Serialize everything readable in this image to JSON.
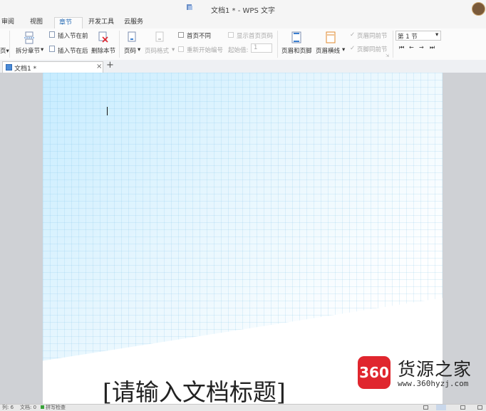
{
  "window": {
    "title": "文档1 * - WPS 文字"
  },
  "menu": {
    "tabs": [
      "审阅",
      "视图",
      "章节",
      "开发工具",
      "云服务"
    ],
    "active": "章节"
  },
  "ribbon": {
    "split_section": "拆分章节",
    "insert_before": "插入节在前",
    "insert_after": "插入节在后",
    "delete_section": "删除本节",
    "page_number": "页码",
    "page_number_format": "页码格式",
    "first_page_different": "首页不同",
    "show_first_page_number": "显示首页页码",
    "restart_numbering": "重新开始编号",
    "start_value_label": "起始值:",
    "start_value": "1",
    "header_footer": "页眉和页脚",
    "header_line": "页眉横线",
    "header_same_as_prev": "页眉同前节",
    "footer_same_as_prev": "页脚同前节",
    "section_select": "第 1 节"
  },
  "doc_tab": {
    "label": "文档1 *",
    "close": "×",
    "add": "+"
  },
  "document": {
    "title_placeholder": "[请输入文档标题]"
  },
  "watermark": {
    "badge": "360",
    "name": "货源之家",
    "url": "www.360hyzj.com"
  },
  "status": {
    "col": "列: 6",
    "words": "文档: 0",
    "spell": "拼写检查"
  },
  "colors": {
    "accent": "#2a6db5",
    "watermark_red": "#e0262e",
    "page_gradient": "#c6ecff"
  }
}
